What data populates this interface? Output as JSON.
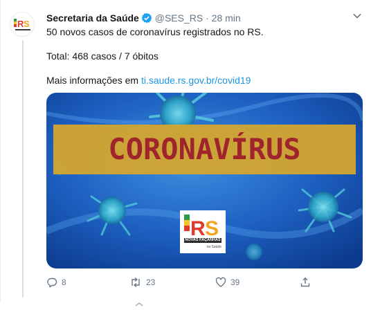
{
  "tweet": {
    "author_name": "Secretaria da Saúde",
    "handle": "@SES_RS",
    "separator": "·",
    "time": "28 min",
    "line1": "50 novos casos de coronavírus registrados no RS.",
    "line2": "Total: 468 casos / 7 óbitos",
    "line3_prefix": "Mais informações em ",
    "link": "ti.saude.rs.gov.br/covid19"
  },
  "avatar": {
    "brand": "RS",
    "gov_text": "GOV",
    "tagline": "NOVAS FAÇANHAS",
    "sub": "Saúde"
  },
  "media": {
    "headline": "CORONAVÍRUS",
    "logo_brand": "RS",
    "logo_gov": "GOV",
    "logo_tagline": "NOVAS FAÇANHAS",
    "logo_sub": "na Saúde"
  },
  "actions": {
    "replies": "8",
    "retweets": "23",
    "likes": "39"
  },
  "colors": {
    "link": "#1b95e0",
    "verified": "#1da1f2",
    "banner": "#d7a72c",
    "banner_text": "#a0242b",
    "brand_red": "#e03a2e",
    "brand_yellow": "#f2c42b",
    "brand_green": "#2e9b45"
  }
}
